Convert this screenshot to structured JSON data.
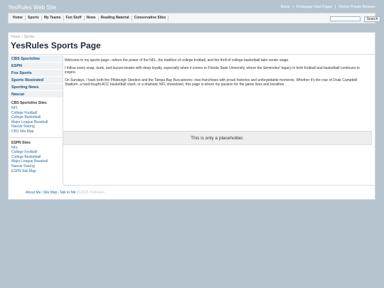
{
  "header": {
    "site_title": "YesRules Web Site",
    "top_links": [
      "Brave",
      "Protopage Start Pages",
      "Norton Private Browser"
    ]
  },
  "nav": {
    "tabs": [
      "Home",
      "Sports",
      "My Teams",
      "Fun Stuff",
      "News",
      "Reading Material",
      "Conservative Sites"
    ],
    "search_value": "",
    "search_button": "Search"
  },
  "breadcrumb": {
    "home": "Home",
    "current": "Sports",
    "divider": "/"
  },
  "page_title": "YesRules Sports Page",
  "sidebar": {
    "items": [
      "CBS Sportsline",
      "ESPN",
      "Fox Sports",
      "Sports Illustrated",
      "Sporting News",
      "Nascar"
    ],
    "box1": {
      "title": "CBS Sportsline Sites",
      "links": [
        "NFL",
        "College Football",
        "College Basketball",
        "Major League Baseball",
        "Nascar Racing",
        "CBS Site Map"
      ]
    },
    "box2": {
      "title": "ESPN Sites",
      "links": [
        "NFL",
        "College Football",
        "College Basketball",
        "Major League Baseball",
        "Nascar Racing",
        "ESPN Site Map"
      ]
    }
  },
  "main": {
    "paragraphs": [
      "Welcome to my sports page—where the power of the NFL, the tradition of college football, and the thrill of college basketball take center stage.",
      "I follow every snap, dunk, and buzzer-beater with deep loyalty, especially when it comes to Florida State University, where the Seminoles' legacy in both football and basketball continues to inspire.",
      "On Sundays, I back both the Pittsburgh Steelers and the Tampa Bay Buccaneers—two franchises with proud histories and unforgettable moments. Whether it's the roar of Doak Campbell Stadium, a hard-fought ACC basketball clash, or a dramatic NFL showdown, this page is where my passion for the game lives and breathes."
    ],
    "placeholder": "This is only a placeholder."
  },
  "footer": {
    "links": [
      "About Me",
      "Site Map",
      "Talk to Me"
    ],
    "copyright": "©2025 YesRules."
  }
}
